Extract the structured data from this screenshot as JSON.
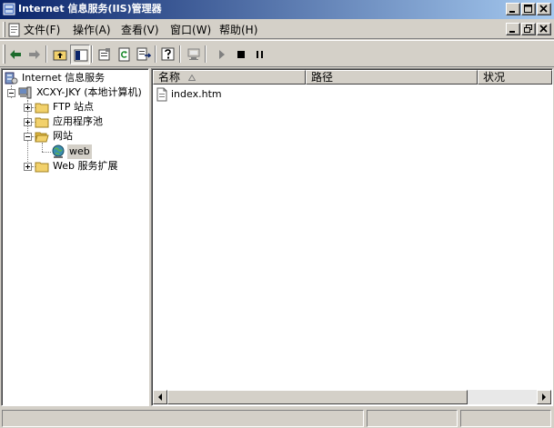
{
  "window": {
    "title": "Internet 信息服务(IIS)管理器"
  },
  "menubar": {
    "items": [
      {
        "label": "文件(F)"
      },
      {
        "label": "操作(A)"
      },
      {
        "label": "查看(V)"
      },
      {
        "label": "窗口(W)"
      },
      {
        "label": "帮助(H)"
      }
    ]
  },
  "toolbar": {
    "buttons": [
      "back-arrow-icon",
      "forward-arrow-icon",
      "up-folder-icon",
      "show-tree-icon",
      "properties-icon",
      "refresh-icon",
      "export-list-icon",
      "help-icon",
      "computer-icon",
      "start-icon",
      "stop-icon",
      "pause-icon"
    ]
  },
  "tree": {
    "root": "Internet 信息服务",
    "computer": "XCXY-JKY (本地计算机)",
    "ftp_sites": "FTP 站点",
    "app_pools": "应用程序池",
    "websites": "网站",
    "web_site": "web",
    "web_ext": "Web 服务扩展"
  },
  "list": {
    "columns": [
      {
        "label": "名称"
      },
      {
        "label": "路径"
      },
      {
        "label": "状况"
      }
    ],
    "rows": [
      {
        "name": "index.htm",
        "path": "",
        "status": ""
      }
    ]
  },
  "colors": {
    "title_start": "#0a246a",
    "title_end": "#a6caf0",
    "face": "#d4d0c8",
    "folder": "#f2d16b",
    "selection": "#d4d0c8"
  }
}
